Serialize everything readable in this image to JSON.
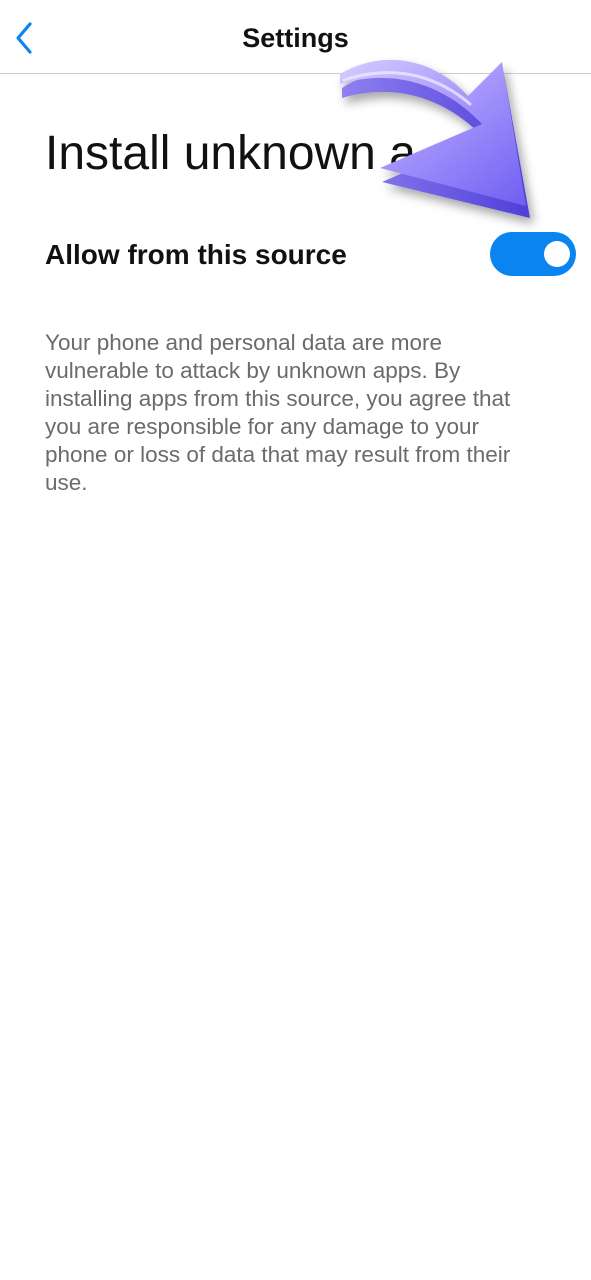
{
  "header": {
    "title": "Settings",
    "back_icon": "chevron-left-icon"
  },
  "page": {
    "title": "Install unknown a"
  },
  "setting": {
    "label": "Allow from this source",
    "toggle_on": true
  },
  "description": "Your phone and personal data are more vulnerable to attack by unknown apps. By installing apps from this source, you agree that you are responsible for any damage to your phone or loss of data that may result from their use.",
  "overlay": {
    "arrow_icon": "pointer-arrow-icon"
  },
  "colors": {
    "accent": "#0a84f0",
    "arrow": "#8b7cf5"
  }
}
